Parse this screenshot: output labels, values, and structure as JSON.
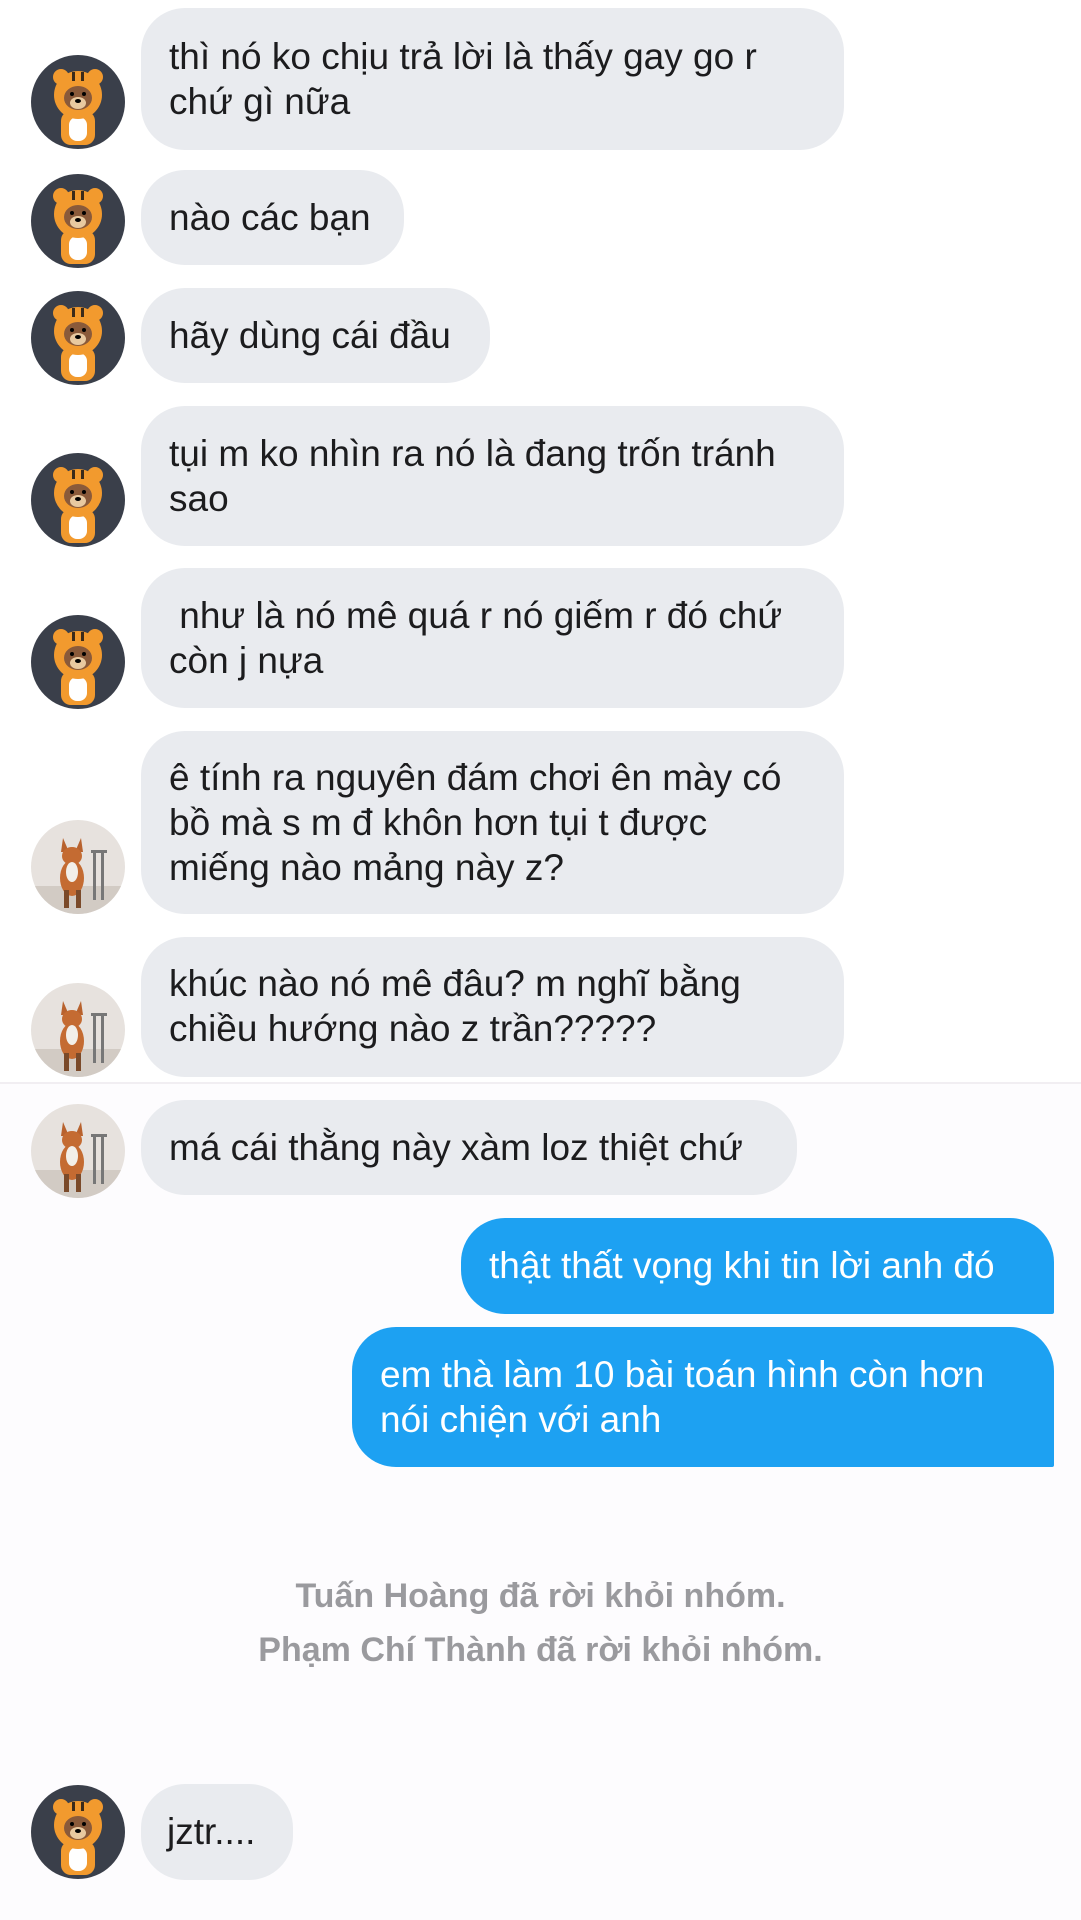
{
  "messages": [
    {
      "sender": "tiger",
      "text": "thì nó ko chịu trả lời là thấy gay go r\nchứ gì nữa"
    },
    {
      "sender": "tiger",
      "text": "nào các bạn"
    },
    {
      "sender": "tiger",
      "text": "hãy dùng cái đầu"
    },
    {
      "sender": "tiger",
      "text": "tụi m ko nhìn ra nó là đang trốn tránh\nsao"
    },
    {
      "sender": "tiger",
      "text": " như là nó mê quá r nó giếm r đó chứ\ncòn j nựa"
    },
    {
      "sender": "fox",
      "text": "ê tính ra nguyên đám chơi ên mày có\nbồ mà s m đ khôn hơn tụi t được\nmiếng nào mảng này z?"
    },
    {
      "sender": "fox",
      "text": "khúc nào nó mê đâu? m nghĩ bằng\nchiều hướng nào z trần?????"
    },
    {
      "sender": "fox",
      "text": "má cái thằng này xàm loz thiệt chứ"
    },
    {
      "sender": "me",
      "text": "thật thất vọng khi tin lời anh đó"
    },
    {
      "sender": "me",
      "text": "em thà làm 10 bài toán hình còn hơn\nnói chiện với anh"
    },
    {
      "sender": "tiger",
      "text": "jztr...."
    }
  ],
  "system_notices": [
    "Tuấn Hoàng đã rời khỏi nhóm.",
    "Phạm Chí Thành đã rời khỏi nhóm."
  ],
  "colors": {
    "incoming_bubble": "#e9ebef",
    "outgoing_bubble": "#1da1f2",
    "system_text": "#9a9a9e"
  },
  "icons": {
    "tiger": "tiger-avatar-icon",
    "fox": "fox-avatar-icon"
  }
}
